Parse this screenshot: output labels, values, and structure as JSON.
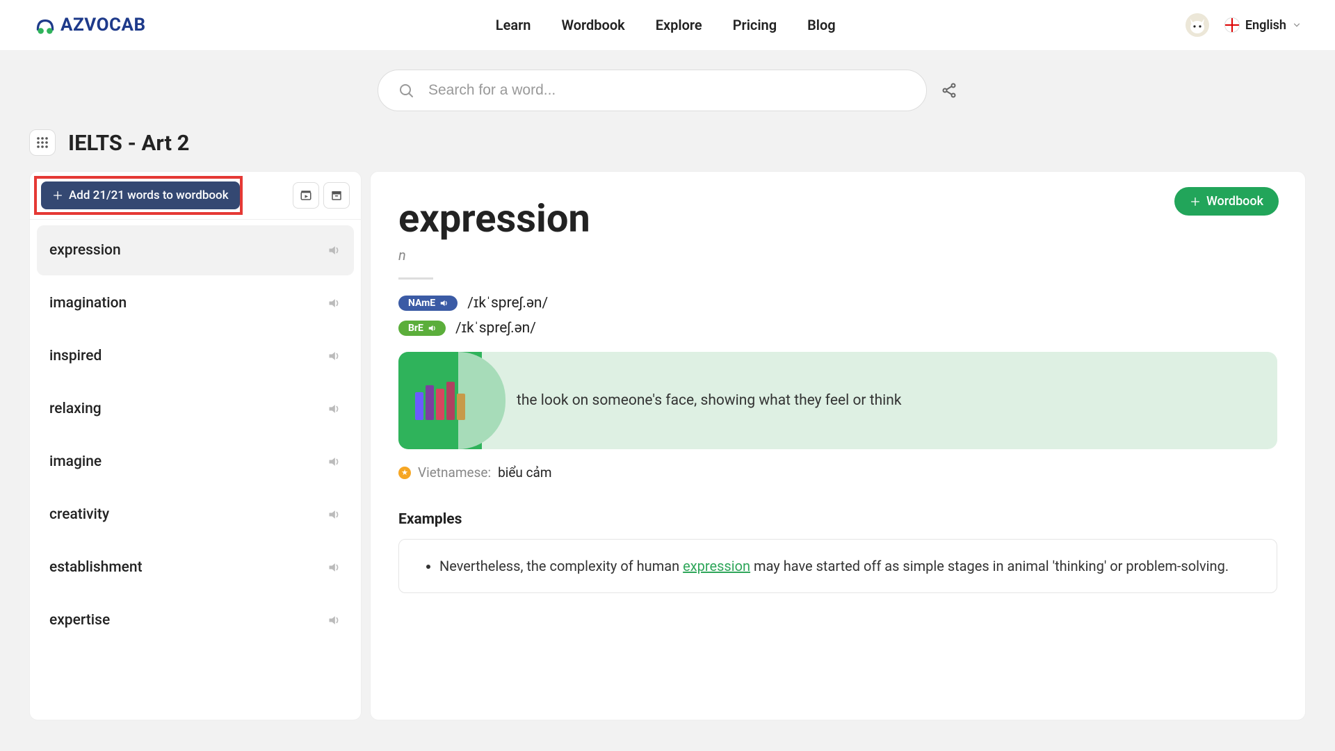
{
  "nav": {
    "logo": "AZVOCAB",
    "links": [
      "Learn",
      "Wordbook",
      "Explore",
      "Pricing",
      "Blog"
    ],
    "language": "English"
  },
  "search": {
    "placeholder": "Search for a word..."
  },
  "page_title": "IELTS - Art 2",
  "sidebar": {
    "add_all_label": "Add 21/21 words to wordbook",
    "words": [
      "expression",
      "imagination",
      "inspired",
      "relaxing",
      "imagine",
      "creativity",
      "establishment",
      "expertise"
    ],
    "active_index": 0
  },
  "detail": {
    "wordbook_btn": "Wordbook",
    "headword": "expression",
    "part_of_speech": "n",
    "pron": {
      "name_label": "NAmE",
      "name_ipa": "/ɪkˈspreʃ.ən/",
      "bre_label": "BrE",
      "bre_ipa": "/ɪkˈspreʃ.ən/"
    },
    "definition": "the look on someone's face, showing what they feel or think",
    "translation": {
      "label": "Vietnamese:",
      "value": "biểu cảm"
    },
    "examples_title": "Examples",
    "examples": [
      {
        "before": "Nevertheless, the complexity of human ",
        "highlight": "expression",
        "after": " may have started off as simple stages in animal 'thinking' or problem-solving."
      }
    ]
  }
}
